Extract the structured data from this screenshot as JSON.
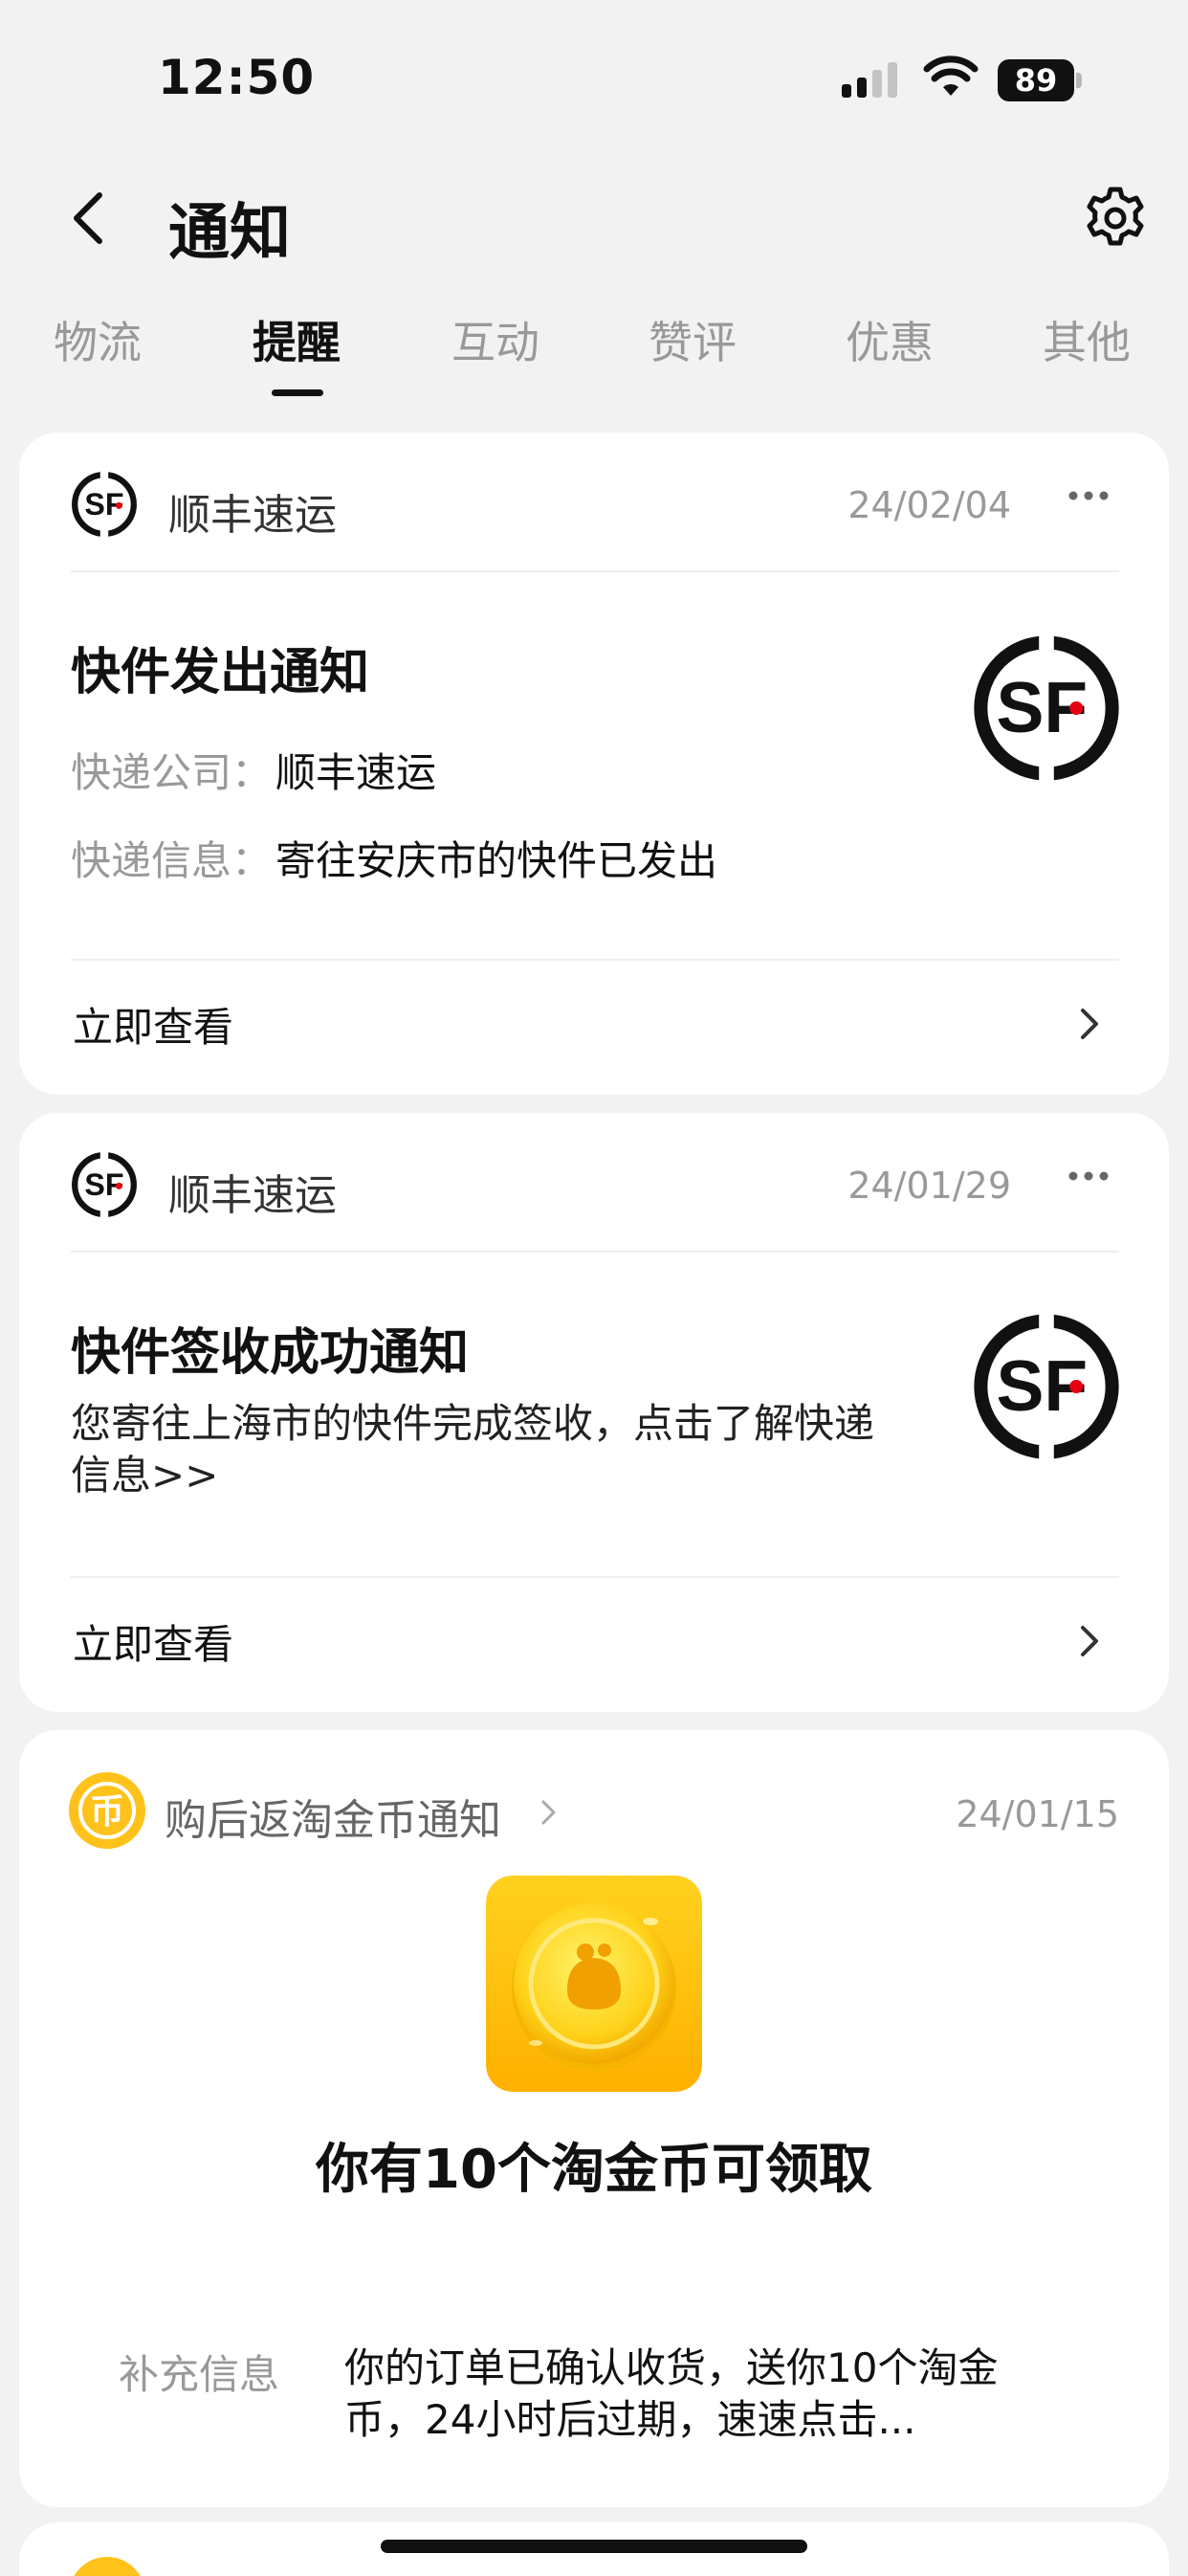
{
  "status_bar": {
    "time": "12:50",
    "battery": "89",
    "icons": [
      "signal-icon",
      "wifi-icon",
      "battery-icon"
    ]
  },
  "nav": {
    "title": "通知",
    "back_icon": "chevron-left-icon",
    "settings_icon": "gear-icon"
  },
  "tabs": {
    "items": [
      {
        "label": "物流"
      },
      {
        "label": "提醒"
      },
      {
        "label": "互动"
      },
      {
        "label": "赞评"
      },
      {
        "label": "优惠"
      },
      {
        "label": "其他"
      }
    ],
    "active": "提醒"
  },
  "cards": [
    {
      "sender": "顺丰速运",
      "date": "24/02/04",
      "title": "快件发出通知",
      "fields": [
        {
          "label": "快递公司：",
          "value": "顺丰速运"
        },
        {
          "label": "快递信息：",
          "value": "寄往安庆市的快件已发出"
        }
      ],
      "action": "立即查看"
    },
    {
      "sender": "顺丰速运",
      "date": "24/01/29",
      "title": "快件签收成功通知",
      "description": "您寄往上海市的快件完成签收，点击了解快递信息>>",
      "action": "立即查看"
    },
    {
      "sender": "购后返淘金币通知",
      "date": "24/01/15",
      "title": "你有10个淘金币可领取",
      "extra_label": "补充信息",
      "extra_value": "你的订单已确认收货，送你10个淘金币，24小时后过期，速速点击..."
    }
  ],
  "colors": {
    "background": "#f2f2f2",
    "card": "#ffffff",
    "sf_red": "#e60012",
    "coin_yellow": "#ffc21a"
  }
}
